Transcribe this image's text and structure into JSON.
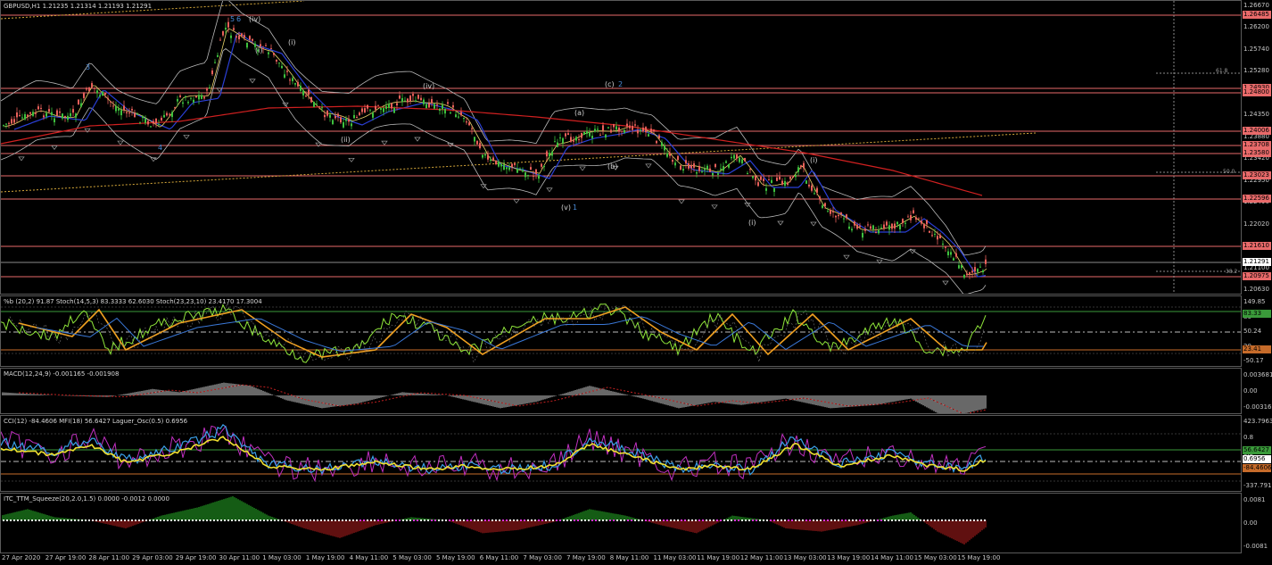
{
  "main": {
    "title": "GBPUSD,H1  1.21235 1.21314 1.21193 1.21291",
    "ticks": [
      "1.26670",
      "1.26200",
      "1.25740",
      "1.25280",
      "1.24810",
      "1.24350",
      "1.23880",
      "1.23420",
      "1.22950",
      "1.22490",
      "1.22020",
      "1.21560",
      "1.21100",
      "1.20630"
    ],
    "tags": [
      {
        "text": "1.26485",
        "color": "#e86a6a"
      },
      {
        "text": "1.24930",
        "color": "#e86a6a"
      },
      {
        "text": "1.24800",
        "color": "#e86a6a"
      },
      {
        "text": "1.24006",
        "color": "#e86a6a"
      },
      {
        "text": "1.23708",
        "color": "#e86a6a"
      },
      {
        "text": "1.23580",
        "color": "#e86a6a"
      },
      {
        "text": "1.23023",
        "color": "#e86a6a"
      },
      {
        "text": "1.22596",
        "color": "#e86a6a"
      },
      {
        "text": "1.21610",
        "color": "#e86a6a"
      },
      {
        "text": "1.21291",
        "color": "#ffffff"
      },
      {
        "text": "1.20975",
        "color": "#e86a6a"
      }
    ],
    "fib": [
      "61.8",
      "50.0",
      "38.2"
    ],
    "wave_labels": [
      "5",
      "6",
      "(iv)",
      "(i)",
      "(i)",
      "3",
      "4",
      "(ii)",
      "(iv)",
      "(a)",
      "(c)",
      "2",
      "(b)",
      "(v)",
      "1",
      "(i)",
      "(i)"
    ]
  },
  "stoch": {
    "label": "%b (20,2) 91.87  Stoch(14,5,3) 83.3333 62.6030  Stoch(23,23,10) 23.4170 17.3004",
    "ticks": [
      "149.85",
      "80",
      "50.24",
      "20",
      "-50.17"
    ],
    "tags": [
      {
        "text": "83.33",
        "color": "#3a9a3a"
      },
      {
        "text": "23.41",
        "color": "#c66b2a"
      }
    ]
  },
  "macd": {
    "label": "MACD(12,24,9) -0.001165 -0.001908",
    "ticks": [
      "0.003681",
      "0.00",
      "-0.003163"
    ]
  },
  "cci": {
    "label": "CCI(12) -84.4606  MFI(18) 56.6427  Laguer_Osc(0.5) 0.6956",
    "ticks": [
      "423.7963",
      "0.8",
      "0.5",
      "0.2",
      "-337.791"
    ],
    "tags": [
      {
        "text": "56.6427",
        "color": "#3a9a3a"
      },
      {
        "text": "0.6956",
        "color": "#ffffff"
      },
      {
        "text": "-84.4606",
        "color": "#c66b2a"
      }
    ]
  },
  "squeeze": {
    "label": "ITC_TTM_Squeeze(20,2.0,1.5) 0.0000 -0.0012 0.0000",
    "ticks": [
      "0.0081",
      "0.00",
      "-0.0081"
    ]
  },
  "dates": [
    "27 Apr 2020",
    "27 Apr 19:00",
    "28 Apr 11:00",
    "29 Apr 03:00",
    "29 Apr 19:00",
    "30 Apr 11:00",
    "1 May 03:00",
    "1 May 19:00",
    "4 May 11:00",
    "5 May 03:00",
    "5 May 19:00",
    "6 May 11:00",
    "7 May 03:00",
    "7 May 19:00",
    "8 May 11:00",
    "11 May 03:00",
    "11 May 19:00",
    "12 May 11:00",
    "13 May 03:00",
    "13 May 19:00",
    "14 May 11:00",
    "15 May 03:00",
    "15 May 19:00"
  ],
  "colors": {
    "bull": "#3ec13e",
    "bear": "#e8605a",
    "level": "#e86a6a",
    "ma_blue": "#2a3fd6",
    "ma_red": "#d02020"
  }
}
